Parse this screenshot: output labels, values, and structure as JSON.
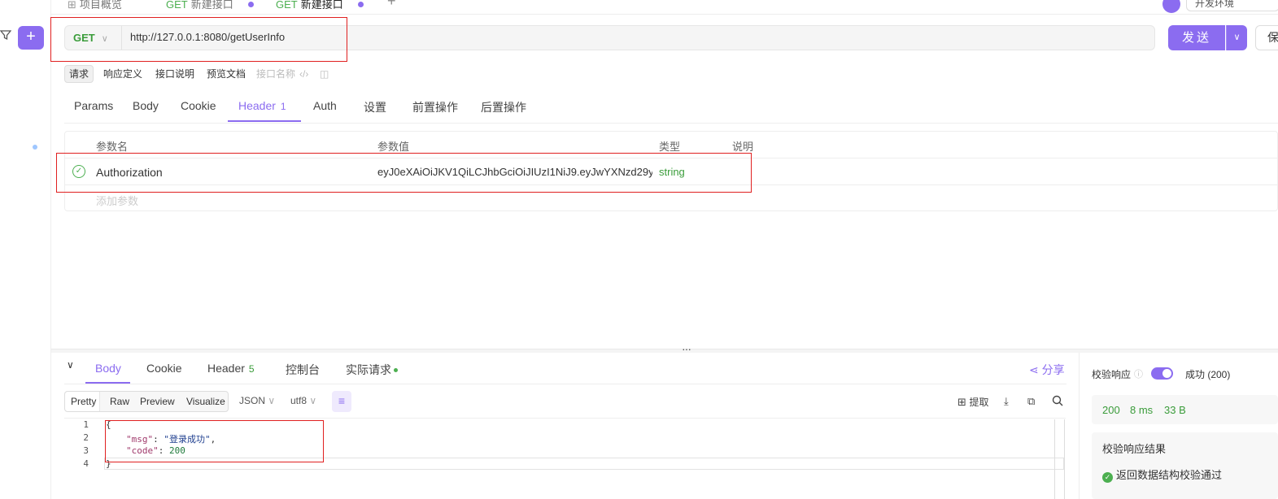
{
  "top_tabs": [
    {
      "label": "项目概览"
    },
    {
      "method": "GET",
      "label": "新建接口"
    },
    {
      "method": "GET",
      "label": "新建接口"
    }
  ],
  "tab_actions": {
    "add": "+",
    "more": "···"
  },
  "env_select": "开发环境",
  "sidebar": {
    "add_label": "+"
  },
  "request": {
    "method": "GET",
    "url": "http://127.0.0.1:8080/getUserInfo",
    "send_label": "发送",
    "save_label": "保"
  },
  "sub_tabs": [
    "请求",
    "响应定义",
    "接口说明",
    "预览文档",
    "接口名称"
  ],
  "req_tabs": [
    {
      "label": "Params"
    },
    {
      "label": "Body"
    },
    {
      "label": "Cookie"
    },
    {
      "label": "Header",
      "count": "1"
    },
    {
      "label": "Auth"
    },
    {
      "label": "设置"
    },
    {
      "label": "前置操作"
    },
    {
      "label": "后置操作"
    }
  ],
  "param_table": {
    "headers": [
      "参数名",
      "参数值",
      "类型",
      "说明"
    ],
    "rows": [
      {
        "name": "Authorization",
        "value": "eyJ0eXAiOiJKV1QiLCJhbGciOiJIUzI1NiJ9.eyJwYXNzd29y",
        "type": "string"
      }
    ],
    "add_placeholder": "添加参数"
  },
  "response": {
    "tabs": [
      {
        "label": "Body"
      },
      {
        "label": "Cookie"
      },
      {
        "label": "Header",
        "count": "5"
      },
      {
        "label": "控制台"
      },
      {
        "label": "实际请求"
      }
    ],
    "share_label": "分享",
    "formats": [
      "Pretty",
      "Raw",
      "Preview",
      "Visualize"
    ],
    "lang": "JSON",
    "encoding": "utf8",
    "extract_label": "提取",
    "code_lines": [
      {
        "num": "1",
        "text": "{"
      },
      {
        "num": "2",
        "key": "\"msg\"",
        "sep": ": ",
        "value": "\"登录成功\"",
        "tail": ","
      },
      {
        "num": "3",
        "key": "\"code\"",
        "sep": ": ",
        "value": "200",
        "tail": ""
      },
      {
        "num": "4",
        "text": "}"
      }
    ]
  },
  "validation": {
    "label": "校验响应",
    "status": "成功 (200)",
    "code": "200",
    "time": "8 ms",
    "size": "33 B",
    "result_title": "校验响应结果",
    "result_text": "返回数据结构校验通过"
  },
  "colors": {
    "accent": "#8b6cf0",
    "success": "#4caf50",
    "highlight": "#e02020"
  }
}
